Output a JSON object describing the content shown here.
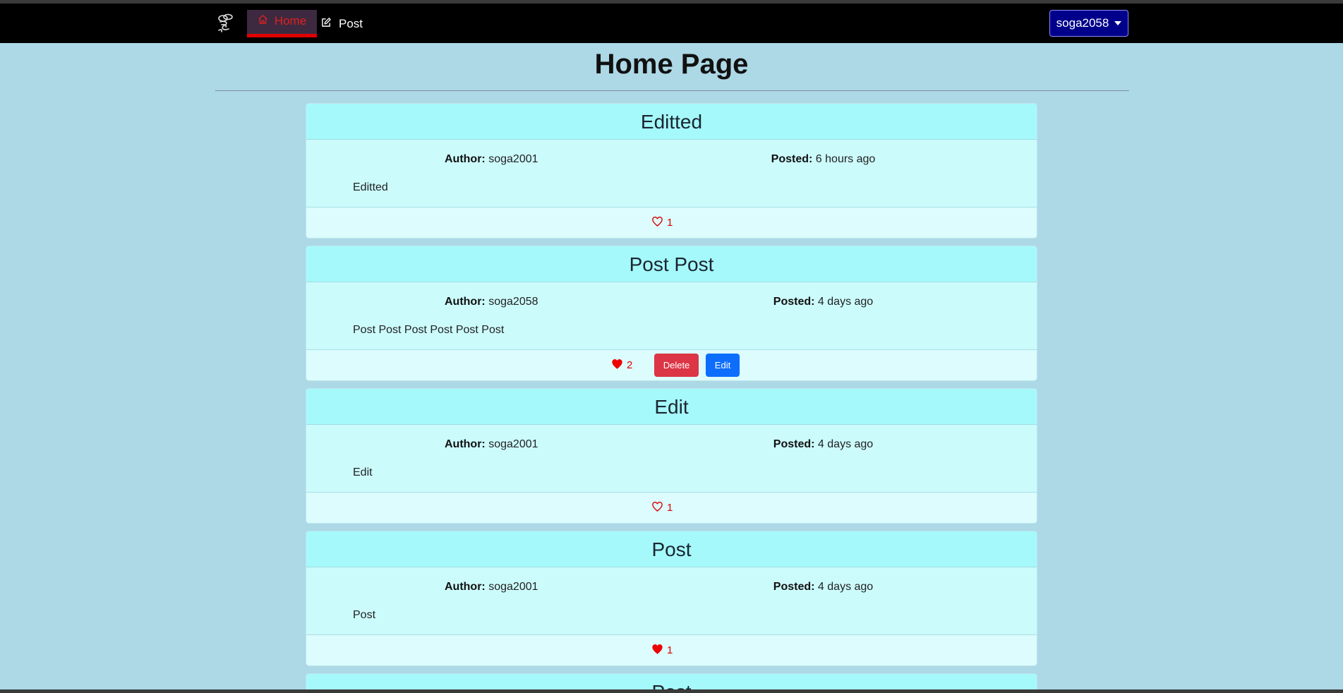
{
  "navbar": {
    "brand_icon": "bee-logo-icon",
    "home_label": "Home",
    "post_label": "Post",
    "user_label": "soga2058"
  },
  "page": {
    "title": "Home Page"
  },
  "labels": {
    "author": "Author:",
    "posted": "Posted:",
    "delete": "Delete",
    "edit": "Edit"
  },
  "posts": [
    {
      "title": "Editted",
      "author": "soga2001",
      "posted": "6 hours ago",
      "body": "Editted",
      "likes": "1",
      "liked": false,
      "owner": false
    },
    {
      "title": "Post Post",
      "author": "soga2058",
      "posted": "4 days ago",
      "body": "Post Post Post Post Post Post",
      "likes": "2",
      "liked": true,
      "owner": true
    },
    {
      "title": "Edit",
      "author": "soga2001",
      "posted": "4 days ago",
      "body": "Edit",
      "likes": "1",
      "liked": false,
      "owner": false
    },
    {
      "title": "Post",
      "author": "soga2001",
      "posted": "4 days ago",
      "body": "Post",
      "likes": "1",
      "liked": true,
      "owner": false
    },
    {
      "title": "Post"
    }
  ],
  "colors": {
    "background": "#add8e6",
    "navbar": "#000000",
    "active_nav": "#e02020",
    "user_button": "#00008b",
    "card_header": "#a5f9fb",
    "delete": "#dc3545",
    "edit": "#0d6efd"
  }
}
